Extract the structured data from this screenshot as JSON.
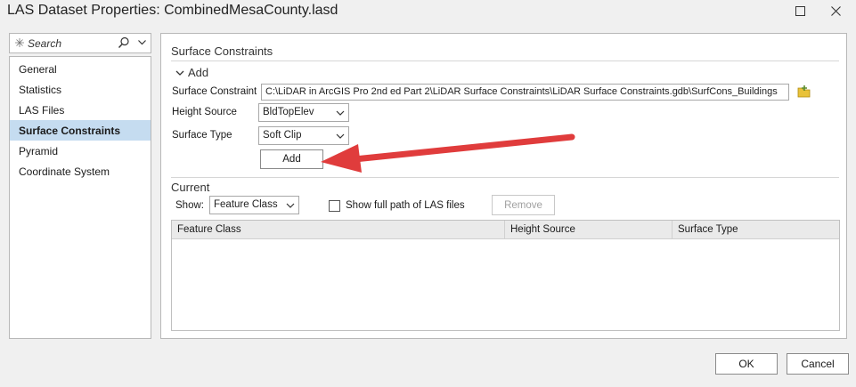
{
  "window": {
    "title": "LAS Dataset Properties: CombinedMesaCounty.lasd"
  },
  "search": {
    "placeholder": "Search"
  },
  "sidebar": {
    "items": [
      {
        "label": "General"
      },
      {
        "label": "Statistics"
      },
      {
        "label": "LAS Files"
      },
      {
        "label": "Surface Constraints",
        "selected": true
      },
      {
        "label": "Pyramid"
      },
      {
        "label": "Coordinate System"
      }
    ]
  },
  "panel": {
    "title": "Surface Constraints",
    "add_section": {
      "label": "Add",
      "surface_constraint_label": "Surface Constraint",
      "surface_constraint_value": "C:\\LiDAR in ArcGIS Pro 2nd ed Part 2\\LiDAR Surface Constraints\\LiDAR Surface Constraints.gdb\\SurfCons_Buildings",
      "height_source_label": "Height Source",
      "height_source_value": "BldTopElev",
      "surface_type_label": "Surface Type",
      "surface_type_value": "Soft Clip",
      "add_button": "Add"
    },
    "current_section": {
      "title": "Current",
      "show_label": "Show:",
      "show_value": "Feature Class",
      "show_full_path_label": "Show full path of LAS files",
      "remove_button": "Remove",
      "columns": [
        "Feature Class",
        "Height Source",
        "Surface Type"
      ]
    }
  },
  "footer": {
    "ok": "OK",
    "cancel": "Cancel"
  },
  "colors": {
    "selection": "#c5dcf0",
    "arrow": "#e03c3c",
    "browse_icon": "#e8c23a"
  }
}
